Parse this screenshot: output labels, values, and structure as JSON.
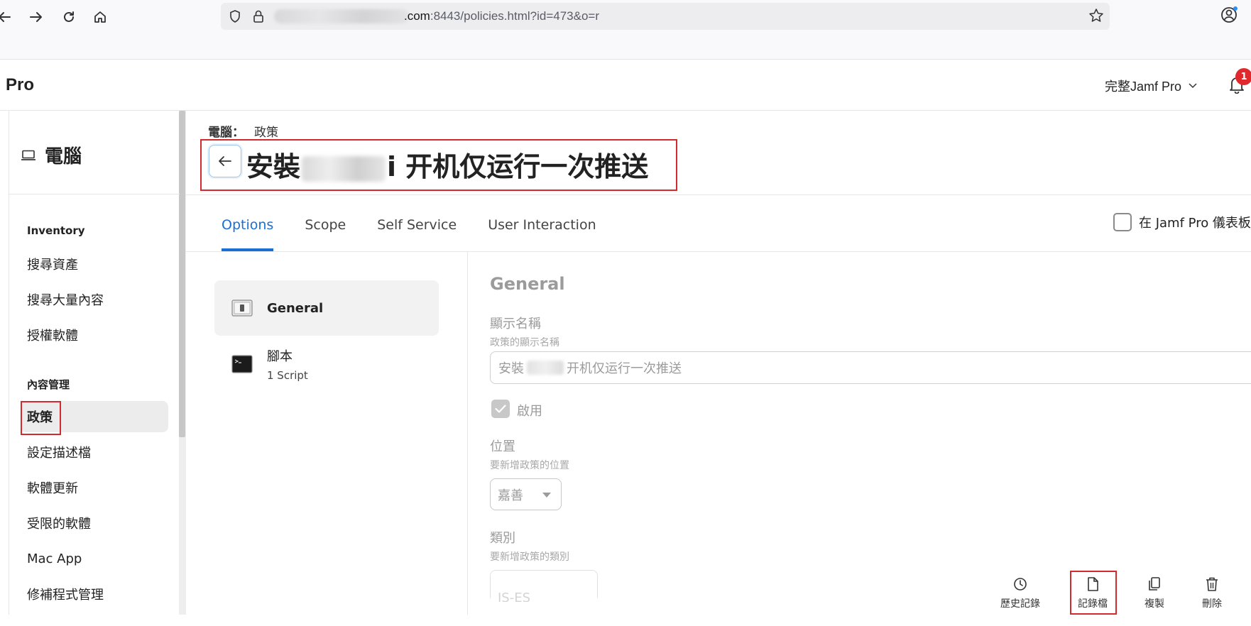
{
  "browser": {
    "url_host_suffix": ".com",
    "url_rest": ":8443/policies.html?id=473&o=r"
  },
  "app": {
    "brand": "Pro",
    "environment_label": "完整Jamf Pro",
    "notification_count": "1"
  },
  "sidebar": {
    "title": "電腦",
    "sections": [
      {
        "heading": "Inventory",
        "items": [
          "搜尋資產",
          "搜尋大量內容",
          "授權軟體"
        ]
      },
      {
        "heading": "內容管理",
        "items": [
          "政策",
          "設定描述檔",
          "軟體更新",
          "受限的軟體",
          "Mac App",
          "修補程式管理"
        ]
      }
    ],
    "active_item": "政策"
  },
  "breadcrumb": {
    "section": "電腦：",
    "page": "政策"
  },
  "page": {
    "title_prefix": "安裝",
    "title_suffix": "i 开机仅运行一次推送"
  },
  "tabs": [
    "Options",
    "Scope",
    "Self Service",
    "User Interaction"
  ],
  "active_tab": "Options",
  "dashboard_checkbox_label": "在 Jamf Pro 儀表板",
  "payloads": [
    {
      "label": "General",
      "sub": ""
    },
    {
      "label": "腳本",
      "sub": "1 Script"
    }
  ],
  "form": {
    "title": "General",
    "display_name_label": "顯示名稱",
    "display_name_help": "政策的顯示名稱",
    "display_name_value_prefix": "安裝",
    "display_name_value_suffix": "开机仅运行一次推送",
    "enabled_label": "啟用",
    "enabled": true,
    "site_label": "位置",
    "site_help": "要新增政策的位置",
    "site_value": "嘉善",
    "category_label": "類別",
    "category_help": "要新增政策的類別",
    "category_value": "JS-ES"
  },
  "actions": [
    {
      "label": "歷史記錄",
      "icon": "clock-icon"
    },
    {
      "label": "記錄檔",
      "icon": "document-icon"
    },
    {
      "label": "複製",
      "icon": "copy-icon"
    },
    {
      "label": "刪除",
      "icon": "trash-icon"
    }
  ],
  "colors": {
    "accent": "#1a6fd0",
    "highlight_box": "#d32a2f",
    "badge": "#e0292d"
  }
}
